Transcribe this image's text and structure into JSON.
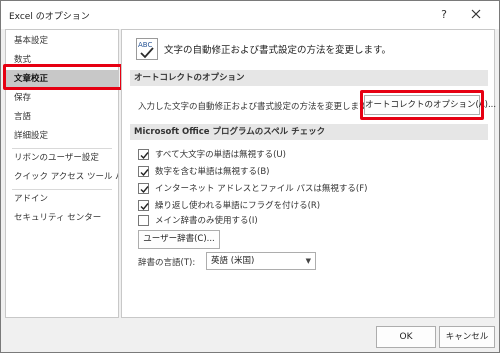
{
  "window": {
    "title": "Excel のオプション",
    "help_label": "?",
    "close_icon": "close-icon"
  },
  "sidebar": {
    "items": [
      {
        "label": "基本設定"
      },
      {
        "label": "数式"
      },
      {
        "label": "文章校正",
        "selected": true
      },
      {
        "label": "保存"
      },
      {
        "label": "言語"
      },
      {
        "label": "詳細設定"
      },
      {
        "label": "リボンのユーザー設定"
      },
      {
        "label": "クイック アクセス ツール バー"
      },
      {
        "label": "アドイン"
      },
      {
        "label": "セキュリティ センター"
      }
    ]
  },
  "main": {
    "heading_icon": "abc-check-icon",
    "heading": "文字の自動修正および書式設定の方法を変更します。",
    "autocorrect_section": {
      "title": "オートコレクトのオプション",
      "description": "入力した文字の自動修正および書式設定の方法を変更します:",
      "button_label": "オートコレクトのオプション(A)..."
    },
    "spelling_section": {
      "title": "Microsoft Office プログラムのスペル チェック",
      "options": [
        {
          "label": "すべて大文字の単語は無視する(U)",
          "checked": true
        },
        {
          "label": "数字を含む単語は無視する(B)",
          "checked": true
        },
        {
          "label": "インターネット アドレスとファイル パスは無視する(F)",
          "checked": true
        },
        {
          "label": "繰り返し使われる単語にフラグを付ける(R)",
          "checked": true
        },
        {
          "label": "メイン辞書のみ使用する(I)",
          "checked": false
        }
      ],
      "user_dictionary_button": "ユーザー辞書(C)...",
      "dictionary_language_label": "辞書の言語(T):",
      "dictionary_language_value": "英語 (米国)"
    }
  },
  "footer": {
    "ok_label": "OK",
    "cancel_label": "キャンセル"
  },
  "colors": {
    "highlight": "#e60012",
    "selected_bg": "#c8c8c8",
    "section_bg": "#e6e6e6"
  }
}
